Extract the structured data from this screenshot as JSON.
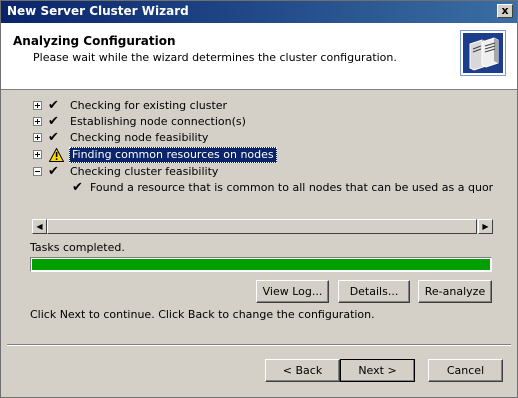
{
  "window": {
    "title": "New Server Cluster Wizard",
    "close_label": "x"
  },
  "header": {
    "title": "Analyzing Configuration",
    "subtitle": "Please wait while the wizard determines the cluster configuration."
  },
  "tree": {
    "items": [
      {
        "label": "Checking for existing cluster",
        "status": "check",
        "expander": "plus"
      },
      {
        "label": "Establishing node connection(s)",
        "status": "check",
        "expander": "plus"
      },
      {
        "label": "Checking node feasibility",
        "status": "check",
        "expander": "plus"
      },
      {
        "label": "Finding common resources on nodes",
        "status": "warning",
        "expander": "plus",
        "selected": true
      },
      {
        "label": "Checking cluster feasibility",
        "status": "check",
        "expander": "minus"
      },
      {
        "label": "Found a resource that is common to all nodes that can be used as a quorum resourc",
        "status": "check",
        "child": true
      }
    ]
  },
  "scrollbar": {
    "left_arrow": "◀",
    "right_arrow": "▶"
  },
  "status": {
    "tasks_label": "Tasks completed.",
    "progress_percent": 100,
    "progress_color": "#00a000"
  },
  "actions": {
    "view_log": "View Log...",
    "details": "Details...",
    "reanalyze": "Re-analyze"
  },
  "info": "Click Next to continue. Click Back to change the configuration.",
  "nav": {
    "back": "< Back",
    "next": "Next >",
    "cancel": "Cancel"
  },
  "colors": {
    "titlebar_start": "#0a246a",
    "titlebar_end": "#3a6ea5",
    "selection": "#0a246a",
    "warning": "#ffd800"
  }
}
